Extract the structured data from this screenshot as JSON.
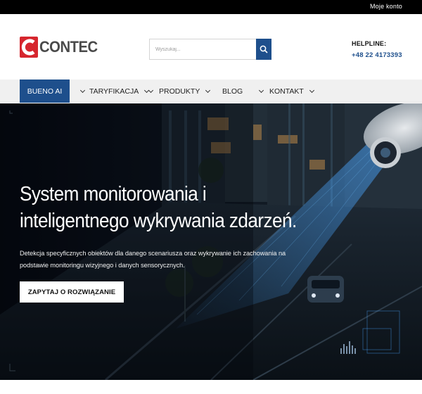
{
  "topbar": {
    "account_link": "Moje konto"
  },
  "brand": {
    "logo_text": "CONTEC",
    "logo_color": "#d6262e"
  },
  "search": {
    "placeholder": "Wyszukaj...",
    "button_icon": "search-icon",
    "button_color": "#1e4f8c"
  },
  "helpline": {
    "label": "HELPLINE:",
    "number": "+48 22 4173393"
  },
  "nav": {
    "items": [
      {
        "label": "BUENO AI",
        "active": true
      },
      {
        "label": "TARYFIKACJA",
        "dropdown": true
      },
      {
        "label": "PRODUKTY",
        "dropdown": true
      },
      {
        "label": "BLOG"
      },
      {
        "label": "KONTAKT",
        "dropdown": true
      }
    ]
  },
  "hero": {
    "headline": "System monitorowania i inteligentnego wykrywania zdarzeń.",
    "description": "Detekcja specyficznych obiektów dla danego scenariusza oraz wykrywanie ich zachowania na podstawie monitoringu wizyjnego i danych sensorycznych.",
    "cta_label": "ZAPYTAJ O ROZWIĄZANIE"
  },
  "colors": {
    "accent": "#1e4f8c",
    "topbar": "#000000",
    "nav_bg": "#f0f0f0"
  }
}
